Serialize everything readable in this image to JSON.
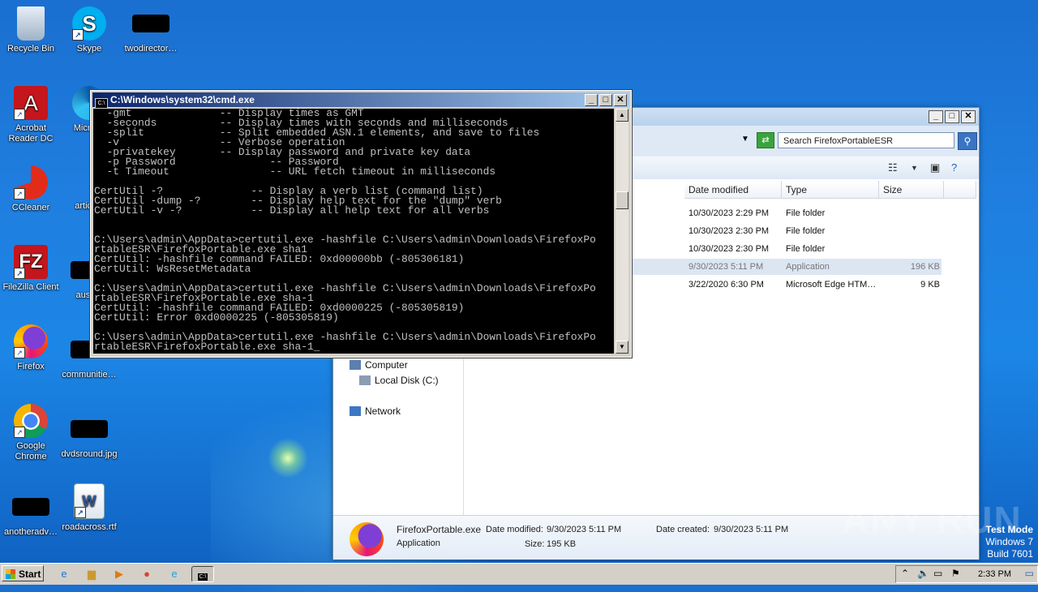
{
  "desktop": {
    "icons": [
      {
        "label": "Recycle Bin",
        "icon": "recycle-bin-icon"
      },
      {
        "label": "Skype",
        "icon": "skype-icon"
      },
      {
        "label": "twodirector…",
        "icon": "file-icon"
      },
      {
        "label": "Acrobat Reader DC",
        "icon": "acrobat-icon"
      },
      {
        "label": "Microso",
        "icon": "edge-icon"
      },
      {
        "label": "CCleaner",
        "icon": "ccleaner-icon"
      },
      {
        "label": "articleb",
        "icon": "file-icon"
      },
      {
        "label": "FileZilla Client",
        "icon": "filezilla-icon"
      },
      {
        "label": "austral",
        "icon": "file-icon"
      },
      {
        "label": "Firefox",
        "icon": "firefox-icon"
      },
      {
        "label": "communitie…",
        "icon": "file-icon"
      },
      {
        "label": "Google Chrome",
        "icon": "chrome-icon"
      },
      {
        "label": "dvdsround.jpg",
        "icon": "file-icon"
      },
      {
        "label": "anotheradv…",
        "icon": "file-icon"
      },
      {
        "label": "roadacross.rtf",
        "icon": "word-doc-icon"
      }
    ]
  },
  "cmd": {
    "title": "C:\\Windows\\system32\\cmd.exe",
    "lines": [
      "  -gmt              -- Display times as GMT",
      "  -seconds          -- Display times with seconds and milliseconds",
      "  -split            -- Split embedded ASN.1 elements, and save to files",
      "  -v                -- Verbose operation",
      "  -privatekey       -- Display password and private key data",
      "  -p Password               -- Password",
      "  -t Timeout                -- URL fetch timeout in milliseconds",
      "",
      "CertUtil -?              -- Display a verb list (command list)",
      "CertUtil -dump -?        -- Display help text for the \"dump\" verb",
      "CertUtil -v -?           -- Display all help text for all verbs",
      "",
      "",
      "C:\\Users\\admin\\AppData>certutil.exe -hashfile C:\\Users\\admin\\Downloads\\FirefoxPo",
      "rtableESR\\FirefoxPortable.exe sha1",
      "CertUtil: -hashfile command FAILED: 0xd00000bb (-805306181)",
      "CertUtil: WsResetMetadata",
      "",
      "C:\\Users\\admin\\AppData>certutil.exe -hashfile C:\\Users\\admin\\Downloads\\FirefoxPo",
      "rtableESR\\FirefoxPortable.exe sha-1",
      "CertUtil: -hashfile command FAILED: 0xd0000225 (-805305819)",
      "CertUtil: Error 0xd0000225 (-805305819)",
      "",
      "C:\\Users\\admin\\AppData>certutil.exe -hashfile C:\\Users\\admin\\Downloads\\FirefoxPo",
      "rtableESR\\FirefoxPortable.exe sha-1_"
    ]
  },
  "explorer": {
    "search_placeholder": "Search FirefoxPortableESR",
    "columns": {
      "date": "Date modified",
      "type": "Type",
      "size": "Size"
    },
    "rows": [
      {
        "date": "10/30/2023 2:29 PM",
        "type": "File folder",
        "size": "",
        "selected": false
      },
      {
        "date": "10/30/2023 2:30 PM",
        "type": "File folder",
        "size": "",
        "selected": false
      },
      {
        "date": "10/30/2023 2:30 PM",
        "type": "File folder",
        "size": "",
        "selected": false
      },
      {
        "date": "9/30/2023 5:11 PM",
        "type": "Application",
        "size": "196 KB",
        "selected": true
      },
      {
        "date": "3/22/2020 6:30 PM",
        "type": "Microsoft Edge HTM…",
        "size": "9 KB",
        "selected": false
      }
    ],
    "nav": {
      "computer": "Computer",
      "local_disk": "Local Disk (C:)",
      "network": "Network"
    },
    "details": {
      "name": "FirefoxPortable.exe",
      "kind": "Application",
      "modified_label": "Date modified:",
      "modified": "9/30/2023 5:11 PM",
      "size_label": "Size:",
      "size": "195 KB",
      "created_label": "Date created:",
      "created": "9/30/2023 5:11 PM"
    }
  },
  "watermark": "ANY RUN",
  "testmode": {
    "line1": "Test Mode",
    "line2": "Windows 7",
    "line3": "Build 7601"
  },
  "taskbar": {
    "start": "Start",
    "clock": "2:33 PM"
  }
}
